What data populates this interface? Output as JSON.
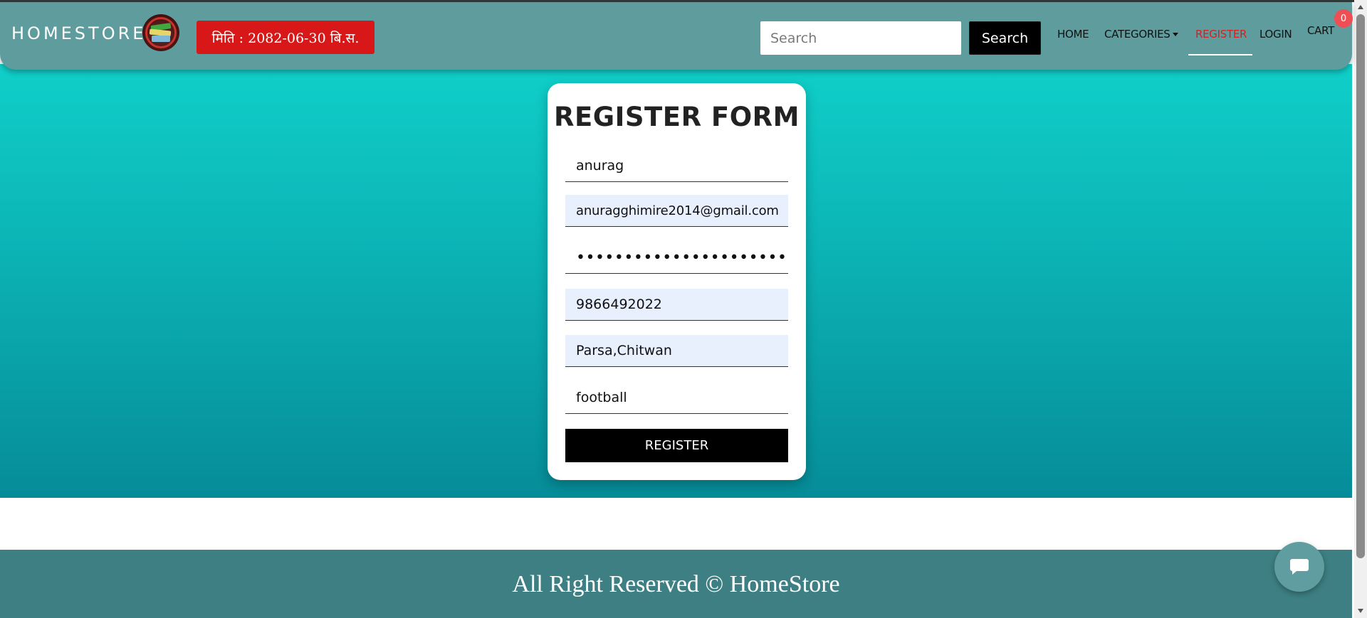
{
  "navbar": {
    "brand": "HOMESTORE",
    "date_badge": "मिति : 2082-06-30 बि.स.",
    "search": {
      "placeholder": "Search",
      "value": "",
      "button_label": "Search"
    },
    "links": {
      "home": "HOME",
      "categories": "CATEGORIES",
      "register": "REGISTER",
      "login": "LOGIN",
      "cart": "CART"
    },
    "cart_count": "0",
    "active_color": "#e01b1b"
  },
  "form": {
    "title": "REGISTER FORM",
    "fields": {
      "name": "anurag",
      "email": "anuragghimire2014@gmail.com",
      "password": "password12345678901234567",
      "phone": "9866492022",
      "address": "Parsa,Chitwan",
      "answer": "football"
    },
    "submit_label": "REGISTER"
  },
  "footer": {
    "text": "All Right Reserved © HomeStore"
  },
  "colors": {
    "navbar": "#5e9c9e",
    "hero_top": "#10cfc9",
    "hero_bottom": "#068c98",
    "footer": "#3d7f83",
    "date_badge": "#d81818"
  },
  "icons": {
    "logo": "books-logo-icon",
    "chat": "chat-bubble-icon"
  }
}
